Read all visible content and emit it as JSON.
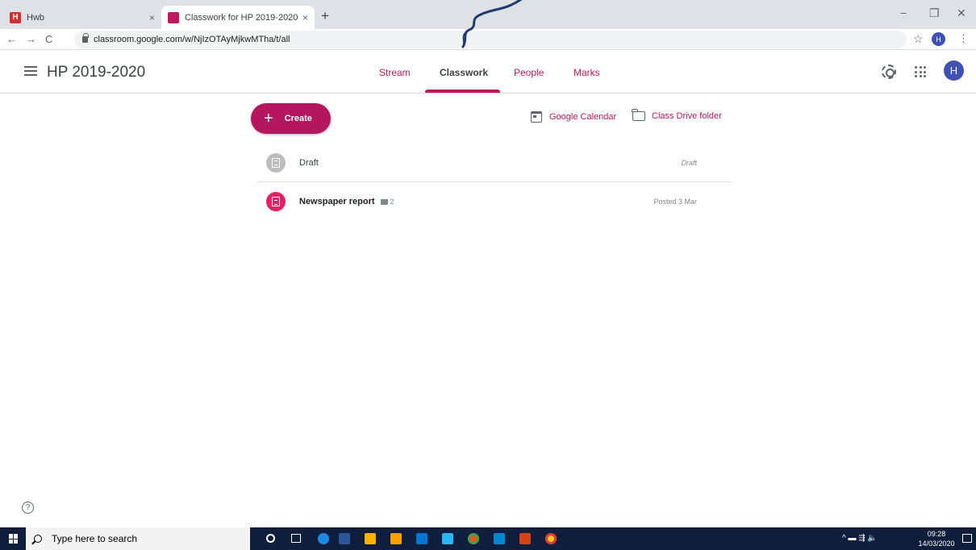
{
  "browser": {
    "tabs": [
      {
        "label": "Hwb",
        "favicon": "H",
        "favicon_color": "#d32f2f",
        "active": false
      },
      {
        "label": "Classwork for HP 2019-2020",
        "favicon": "",
        "favicon_color": "#c2185b",
        "active": true
      }
    ],
    "new_tab_label": "+",
    "close_label": "×",
    "window_controls": {
      "minimize": "−",
      "restore": "❐",
      "close": "✕"
    },
    "nav": {
      "back": "←",
      "forward": "→",
      "reload": "C"
    },
    "url": "classroom.google.com/w/NjIzOTAyMjkwMTha/t/all",
    "star": "☆",
    "profile_initial": "H",
    "menu": "⋮"
  },
  "header": {
    "class_title": "HP 2019-2020",
    "tabs": [
      {
        "label": "Stream",
        "active": false
      },
      {
        "label": "Classwork",
        "active": true
      },
      {
        "label": "People",
        "active": false
      },
      {
        "label": "Marks",
        "active": false
      }
    ],
    "avatar_initial": "H",
    "accent_color": "#c2185b"
  },
  "toolbar": {
    "create_label": "Create",
    "create_plus": "+",
    "calendar_label": "Google Calendar",
    "drive_label": "Class Drive folder"
  },
  "items": [
    {
      "title": "Draft",
      "status": "Draft",
      "icon_color": "#bdbdbd",
      "comments": null
    },
    {
      "title": "Newspaper report",
      "status": "Posted 3 Mar",
      "icon_color": "#e91e63",
      "comments": "2"
    }
  ],
  "help": "?",
  "taskbar": {
    "search_placeholder": "Type here to search",
    "tray_symbols": "^ ▬ ⇶ 🔈",
    "time": "09:28",
    "date": "14/03/2020",
    "app_colors": [
      "#1e88e5",
      "#2b579a",
      "#ffb300",
      "#ffa000",
      "#0078d4",
      "#29b6f6",
      "#f4511e",
      "#0288d1",
      "#d84315",
      "#ffca28"
    ]
  }
}
